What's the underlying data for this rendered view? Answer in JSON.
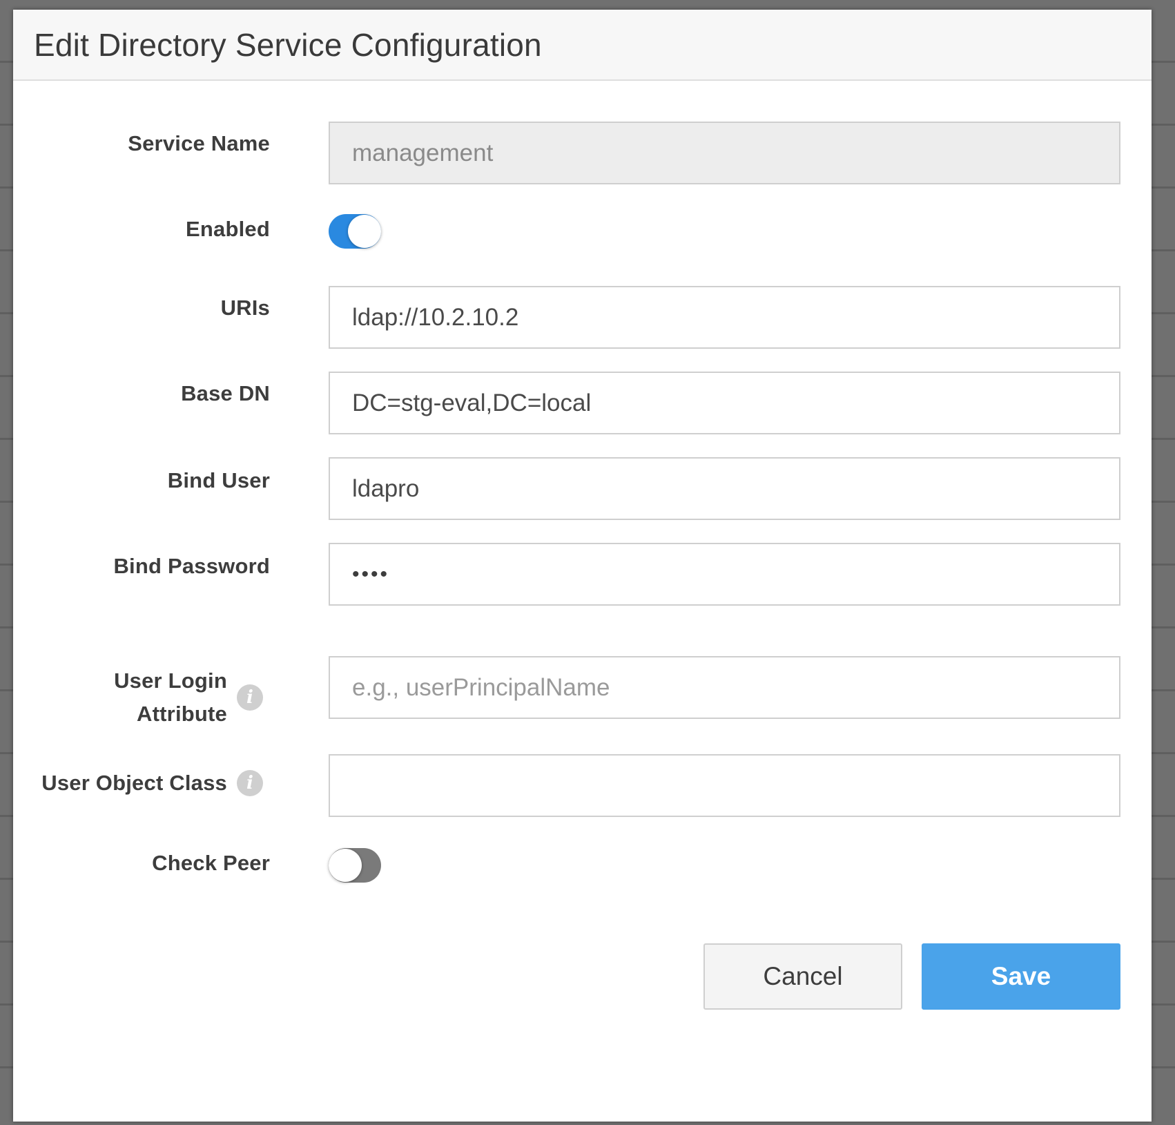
{
  "dialog": {
    "title": "Edit Directory Service Configuration"
  },
  "fields": {
    "service_name": {
      "label": "Service Name",
      "value": "management"
    },
    "enabled": {
      "label": "Enabled",
      "state": "on"
    },
    "uris": {
      "label": "URIs",
      "value": "ldap://10.2.10.2"
    },
    "base_dn": {
      "label": "Base DN",
      "value": "DC=stg-eval,DC=local"
    },
    "bind_user": {
      "label": "Bind User",
      "value": "ldapro"
    },
    "bind_password": {
      "label": "Bind Password",
      "masked_value": "••••"
    },
    "user_login_attribute": {
      "label_line1": "User Login",
      "label_line2": "Attribute",
      "value": "",
      "placeholder": "e.g., userPrincipalName",
      "info_icon": "info-icon"
    },
    "user_object_class": {
      "label": "User Object Class",
      "value": "",
      "info_icon": "info-icon"
    },
    "check_peer": {
      "label": "Check Peer",
      "state": "off"
    }
  },
  "buttons": {
    "cancel_label": "Cancel",
    "save_label": "Save"
  },
  "colors": {
    "toggle_on": "#2a89e0",
    "toggle_off": "#7a7a7a",
    "save_button": "#4aa3ea",
    "readonly_field": "#ededed"
  },
  "info_glyph": "i"
}
